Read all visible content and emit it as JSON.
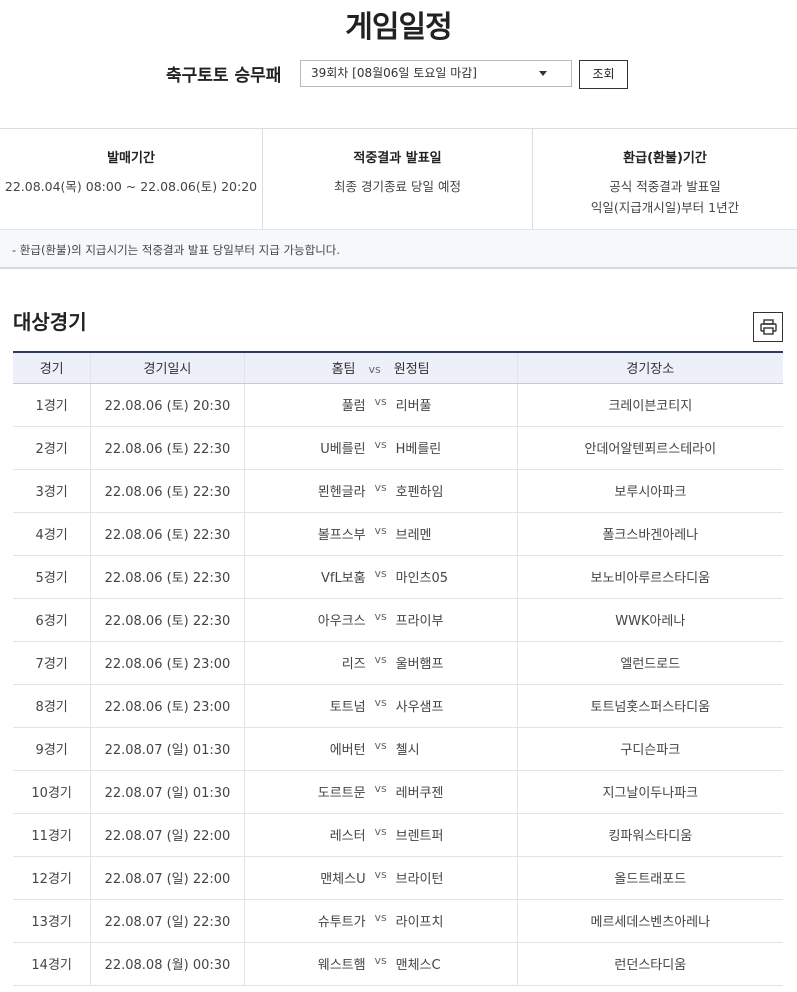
{
  "page_title": "게임일정",
  "selector": {
    "label": "축구토토 승무패",
    "selected": "39회차 [08월06일 토요일 마감]",
    "button": "조회"
  },
  "info": {
    "sales": {
      "heading": "발매기간",
      "value": "22.08.04(목) 08:00 ~ 22.08.06(토) 20:20"
    },
    "result": {
      "heading": "적중결과 발표일",
      "value": "최종 경기종료 당일 예정"
    },
    "refund": {
      "heading": "환급(환불)기간",
      "line1": "공식 적중결과 발표일",
      "line2": "익일(지급개시일)부터 1년간"
    }
  },
  "notice": "- 환급(환불)의 지급시기는 적중결과 발표 당일부터 지급 가능합니다.",
  "section_title": "대상경기",
  "table": {
    "headers": {
      "game": "경기",
      "datetime": "경기일시",
      "home": "홈팀",
      "vs": "vs",
      "away": "원정팀",
      "venue": "경기장소"
    },
    "rows": [
      {
        "game": "1경기",
        "datetime": "22.08.06 (토) 20:30",
        "home": "풀럼",
        "away": "리버풀",
        "venue": "크레이븐코티지"
      },
      {
        "game": "2경기",
        "datetime": "22.08.06 (토) 22:30",
        "home": "U베를린",
        "away": "H베를린",
        "venue": "안데어알텐푀르스테라이"
      },
      {
        "game": "3경기",
        "datetime": "22.08.06 (토) 22:30",
        "home": "묀헨글라",
        "away": "호펜하임",
        "venue": "보루시아파크"
      },
      {
        "game": "4경기",
        "datetime": "22.08.06 (토) 22:30",
        "home": "볼프스부",
        "away": "브레멘",
        "venue": "폴크스바겐아레나"
      },
      {
        "game": "5경기",
        "datetime": "22.08.06 (토) 22:30",
        "home": "VfL보훔",
        "away": "마인츠05",
        "venue": "보노비아루르스타디움"
      },
      {
        "game": "6경기",
        "datetime": "22.08.06 (토) 22:30",
        "home": "아우크스",
        "away": "프라이부",
        "venue": "WWK아레나"
      },
      {
        "game": "7경기",
        "datetime": "22.08.06 (토) 23:00",
        "home": "리즈",
        "away": "울버햄프",
        "venue": "엘런드로드"
      },
      {
        "game": "8경기",
        "datetime": "22.08.06 (토) 23:00",
        "home": "토트넘",
        "away": "사우샘프",
        "venue": "토트넘홋스퍼스타디움"
      },
      {
        "game": "9경기",
        "datetime": "22.08.07 (일) 01:30",
        "home": "에버턴",
        "away": "첼시",
        "venue": "구디슨파크"
      },
      {
        "game": "10경기",
        "datetime": "22.08.07 (일) 01:30",
        "home": "도르트문",
        "away": "레버쿠젠",
        "venue": "지그날이두나파크"
      },
      {
        "game": "11경기",
        "datetime": "22.08.07 (일) 22:00",
        "home": "레스터",
        "away": "브렌트퍼",
        "venue": "킹파워스타디움"
      },
      {
        "game": "12경기",
        "datetime": "22.08.07 (일) 22:00",
        "home": "맨체스U",
        "away": "브라이턴",
        "venue": "올드트래포드"
      },
      {
        "game": "13경기",
        "datetime": "22.08.07 (일) 22:30",
        "home": "슈투트가",
        "away": "라이프치",
        "venue": "메르세데스벤츠아레나"
      },
      {
        "game": "14경기",
        "datetime": "22.08.08 (월) 00:30",
        "home": "웨스트햄",
        "away": "맨체스C",
        "venue": "런던스타디움"
      }
    ]
  }
}
